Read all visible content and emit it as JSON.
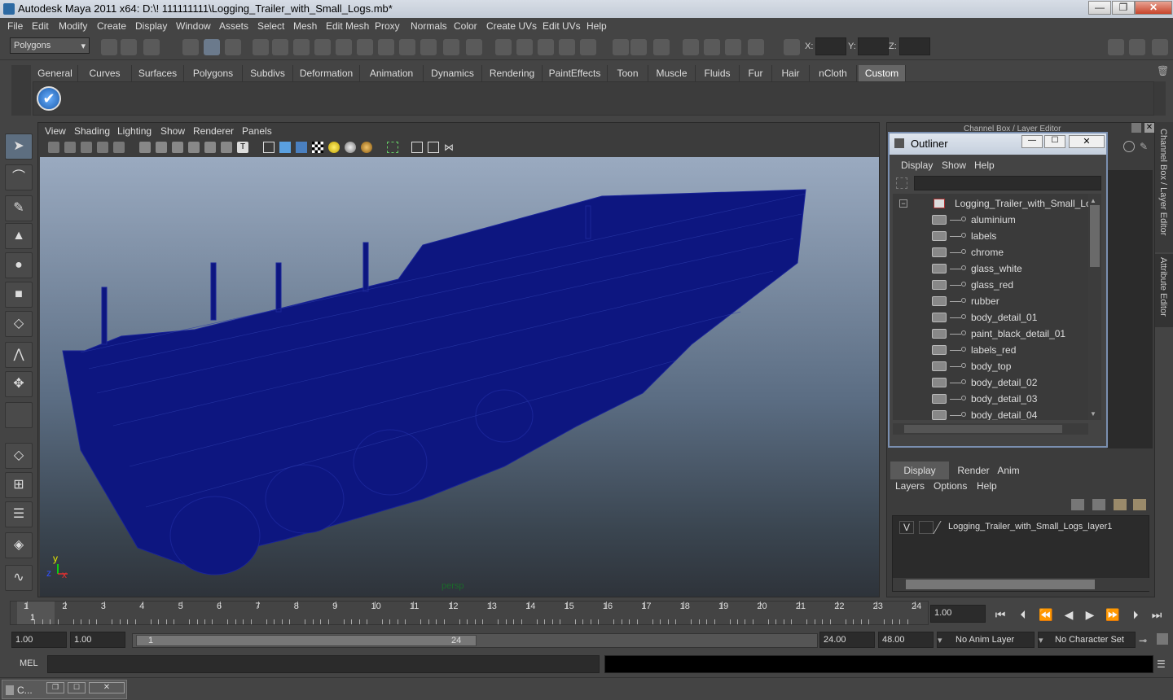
{
  "title": "Autodesk Maya 2011 x64: D:\\! 111111111\\Logging_Trailer_with_Small_Logs.mb*",
  "menubar": [
    "File",
    "Edit",
    "Modify",
    "Create",
    "Display",
    "Window",
    "Assets",
    "Select",
    "Mesh",
    "Edit Mesh",
    "Proxy",
    "Normals",
    "Color",
    "Create UVs",
    "Edit UVs",
    "Help"
  ],
  "mode_selector": "Polygons",
  "coords": {
    "x_label": "X:",
    "y_label": "Y:",
    "z_label": "Z:"
  },
  "shelf_tabs": [
    "General",
    "Curves",
    "Surfaces",
    "Polygons",
    "Subdivs",
    "Deformation",
    "Animation",
    "Dynamics",
    "Rendering",
    "PaintEffects",
    "Toon",
    "Muscle",
    "Fluids",
    "Fur",
    "Hair",
    "nCloth",
    "Custom"
  ],
  "shelf_active": "Custom",
  "viewport": {
    "menu": [
      "View",
      "Shading",
      "Lighting",
      "Show",
      "Renderer",
      "Panels"
    ],
    "camera_label": "persp",
    "axis_y": "y",
    "axis_x": "x",
    "axis_z": "z"
  },
  "outliner": {
    "title": "Outliner",
    "menu": [
      "Display",
      "Show",
      "Help"
    ],
    "root": "Logging_Trailer_with_Small_Logs",
    "items": [
      "aluminium",
      "labels",
      "chrome",
      "glass_white",
      "glass_red",
      "rubber",
      "body_detail_01",
      "paint_black_detail_01",
      "labels_red",
      "body_top",
      "body_detail_02",
      "body_detail_03",
      "body_detail_04"
    ]
  },
  "channel_box_label": "Channel Box / Layer Editor",
  "side_tabs": [
    "Channel Box / Layer Editor",
    "Attribute Editor"
  ],
  "layer_editor": {
    "tabs": [
      "Display",
      "Render",
      "Anim"
    ],
    "active_tab": "Display",
    "menu": [
      "Layers",
      "Options",
      "Help"
    ],
    "layer_visibility": "V",
    "layer_name": "Logging_Trailer_with_Small_Logs_layer1"
  },
  "timeline": {
    "ticks": [
      "1",
      "2",
      "3",
      "4",
      "5",
      "6",
      "7",
      "8",
      "9",
      "10",
      "11",
      "12",
      "13",
      "14",
      "15",
      "16",
      "17",
      "18",
      "19",
      "20",
      "21",
      "22",
      "23",
      "24"
    ],
    "current_frame_marker": "1",
    "current_time": "1.00"
  },
  "range": {
    "start_time": "1.00",
    "playback_start": "1.00",
    "range_slider_start": "1",
    "range_slider_end": "24",
    "playback_end": "24.00",
    "end_time": "48.00",
    "anim_layer": "No Anim Layer",
    "character_set": "No Character Set"
  },
  "command_line": {
    "label": "MEL",
    "value": ""
  },
  "taskbar": {
    "label": "C..."
  },
  "colors": {
    "wireframe": "#0d1680",
    "accent": "#7a8fb0",
    "bg": "#444444"
  }
}
